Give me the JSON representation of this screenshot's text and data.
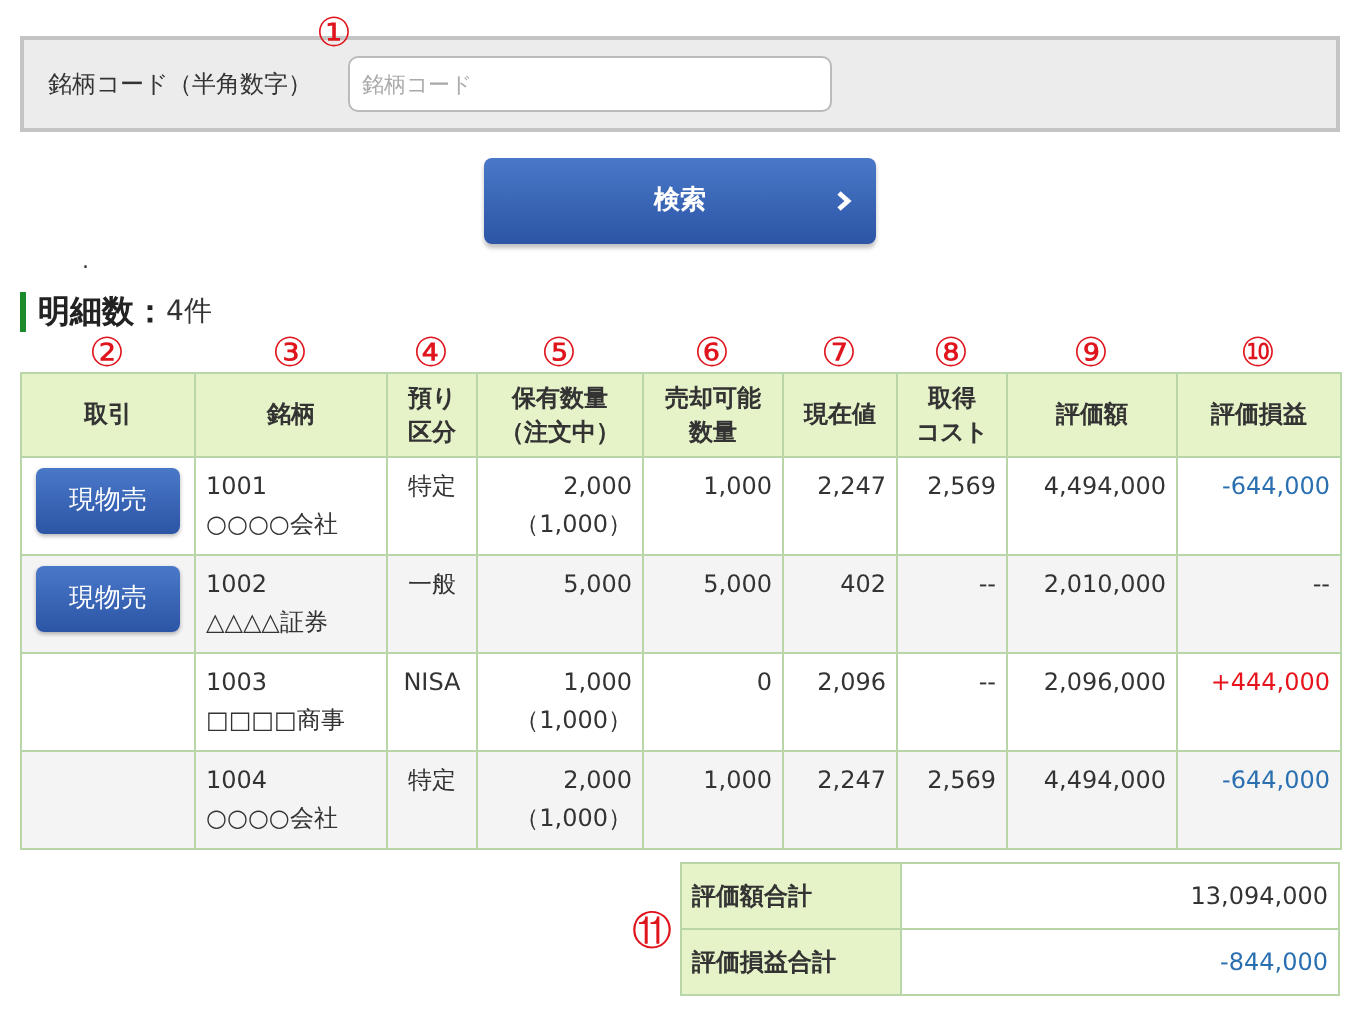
{
  "search": {
    "label": "銘柄コード（半角数字）",
    "marker": "①",
    "placeholder": "銘柄コード",
    "button": "検索",
    "note": "."
  },
  "summary_heading": {
    "label": "明細数：",
    "count": "4件"
  },
  "columns": [
    {
      "label": [
        "取引"
      ],
      "marker": "②"
    },
    {
      "label": [
        "銘柄"
      ],
      "marker": "③"
    },
    {
      "label": [
        "預り",
        "区分"
      ],
      "marker": "④"
    },
    {
      "label": [
        "保有数量",
        "（注文中）"
      ],
      "marker": "⑤"
    },
    {
      "label": [
        "売却可能",
        "数量"
      ],
      "marker": "⑥"
    },
    {
      "label": [
        "現在値"
      ],
      "marker": "⑦"
    },
    {
      "label": [
        "取得",
        "コスト"
      ],
      "marker": "⑧"
    },
    {
      "label": [
        "評価額"
      ],
      "marker": "⑨"
    },
    {
      "label": [
        "評価損益"
      ],
      "marker": "⑩"
    }
  ],
  "rows": [
    {
      "action": "現物売",
      "code": "1001",
      "name": "○○○○会社",
      "account": "特定",
      "quantity": "2,000",
      "ordered": "（1,000）",
      "sellable": "1,000",
      "price": "2,247",
      "cost": "2,569",
      "value": "4,494,000",
      "pnl": "-644,000",
      "color": "#2a6fb0"
    },
    {
      "action": "現物売",
      "code": "1002",
      "name": "△△△△証券",
      "account": "一般",
      "quantity": "5,000",
      "sellable": "5,000",
      "price": "402",
      "cost": "--",
      "value": "2,010,000",
      "pnl": "--",
      "color": "#333333"
    },
    {
      "code": "1003",
      "name": "□□□□商事",
      "account": "NISA",
      "quantity": "1,000",
      "ordered": "（1,000）",
      "sellable": "0",
      "price": "2,096",
      "cost": "--",
      "value": "2,096,000",
      "pnl": "+444,000",
      "color": "#e8141c"
    },
    {
      "code": "1004",
      "name": "○○○○会社",
      "account": "特定",
      "quantity": "2,000",
      "ordered": "（1,000）",
      "sellable": "1,000",
      "price": "2,247",
      "cost": "2,569",
      "value": "4,494,000",
      "pnl": "-644,000",
      "color": "#2a6fb0"
    }
  ],
  "totals": {
    "marker": "⑪",
    "rows": [
      {
        "label": "評価額合計",
        "value": "13,094,000",
        "color": "#333333"
      },
      {
        "label": "評価損益合計",
        "value": "-844,000",
        "color": "#2a6fb0"
      }
    ]
  }
}
